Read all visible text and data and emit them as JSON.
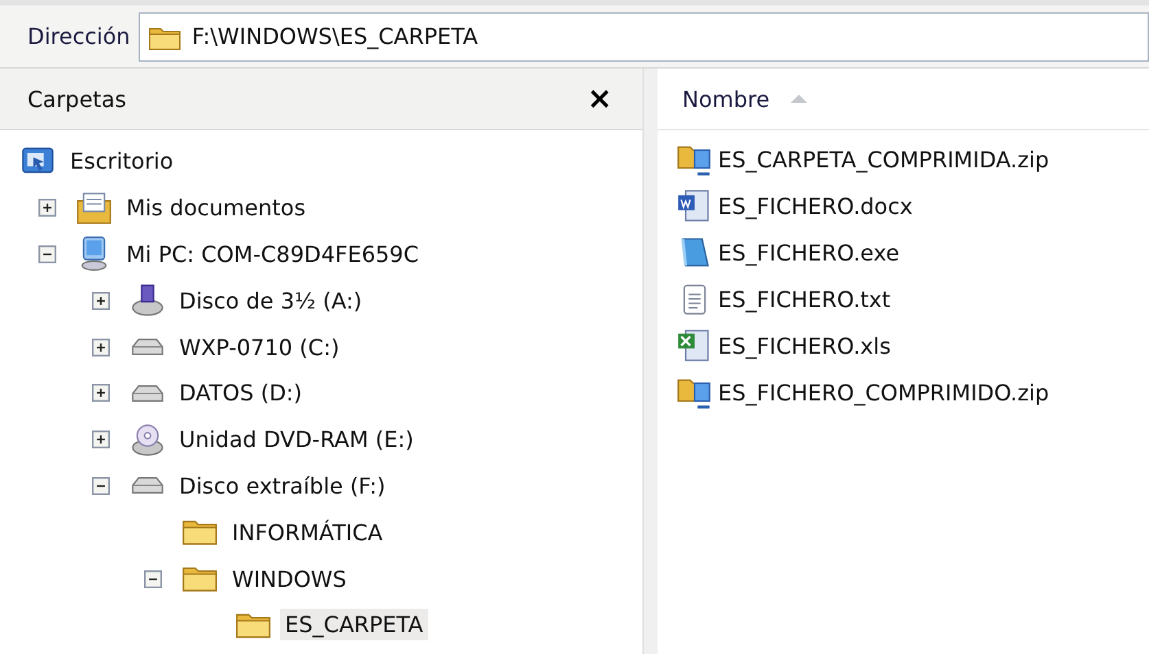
{
  "address_bar": {
    "label": "Dirección",
    "value": "F:\\WINDOWS\\ES_CARPETA"
  },
  "folders_pane": {
    "title": "Carpetas",
    "close": "×",
    "tree": [
      {
        "label": "Escritorio",
        "kind": "desktop",
        "selected": false,
        "children": [
          {
            "label": "Mis documentos",
            "kind": "documents",
            "expanded": false,
            "selected": false
          },
          {
            "label": "Mi PC: COM-C89D4FE659C",
            "kind": "computer",
            "expanded": true,
            "selected": false,
            "children": [
              {
                "label": "Disco de 3½ (A:)",
                "kind": "floppy",
                "expanded": false,
                "selected": false
              },
              {
                "label": "WXP-0710 (C:)",
                "kind": "drive",
                "expanded": false,
                "selected": false
              },
              {
                "label": "DATOS (D:)",
                "kind": "drive",
                "expanded": false,
                "selected": false
              },
              {
                "label": "Unidad DVD-RAM (E:)",
                "kind": "dvd",
                "expanded": false,
                "selected": false
              },
              {
                "label": "Disco extraíble (F:)",
                "kind": "drive",
                "expanded": true,
                "selected": false,
                "children": [
                  {
                    "label": "INFORMÁTICA",
                    "kind": "folder",
                    "selected": false
                  },
                  {
                    "label": "WINDOWS",
                    "kind": "folder",
                    "expanded": true,
                    "selected": false,
                    "children": [
                      {
                        "label": "ES_CARPETA",
                        "kind": "folder",
                        "selected": true
                      }
                    ]
                  }
                ]
              }
            ]
          }
        ]
      }
    ]
  },
  "file_list": {
    "column": "Nombre",
    "files": [
      {
        "name": "ES_CARPETA_COMPRIMIDA.zip",
        "kind": "zip"
      },
      {
        "name": "ES_FICHERO.docx",
        "kind": "word"
      },
      {
        "name": "ES_FICHERO.exe",
        "kind": "exe"
      },
      {
        "name": "ES_FICHERO.txt",
        "kind": "txt"
      },
      {
        "name": "ES_FICHERO.xls",
        "kind": "excel"
      },
      {
        "name": "ES_FICHERO_COMPRIMIDO.zip",
        "kind": "zip"
      }
    ]
  }
}
